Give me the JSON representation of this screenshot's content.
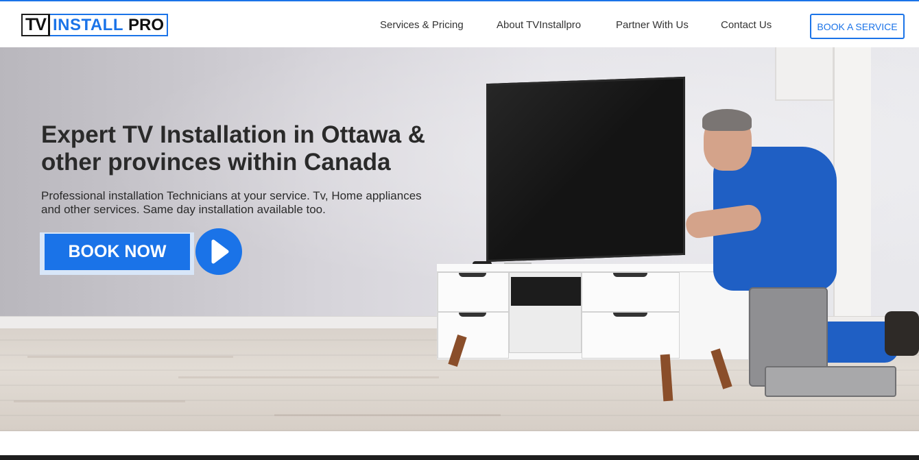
{
  "brand": {
    "logo_tv": "TV",
    "logo_install": "INSTALL",
    "logo_pro": "PRO",
    "accent_color": "#1a73e8"
  },
  "nav": {
    "items": [
      {
        "label": "Services & Pricing"
      },
      {
        "label": "About TVInstallpro"
      },
      {
        "label": "Partner With Us"
      },
      {
        "label": "Contact Us"
      }
    ],
    "cta_label": "BOOK A SERVICE"
  },
  "hero": {
    "title": "Expert TV Installation in Ottawa & other provinces within Canada",
    "subtitle": "Professional installation Technicians at your service. Tv, Home appliances and other services. Same day installation available too.",
    "book_now_label": "BOOK NOW",
    "play_icon": "play-icon"
  }
}
